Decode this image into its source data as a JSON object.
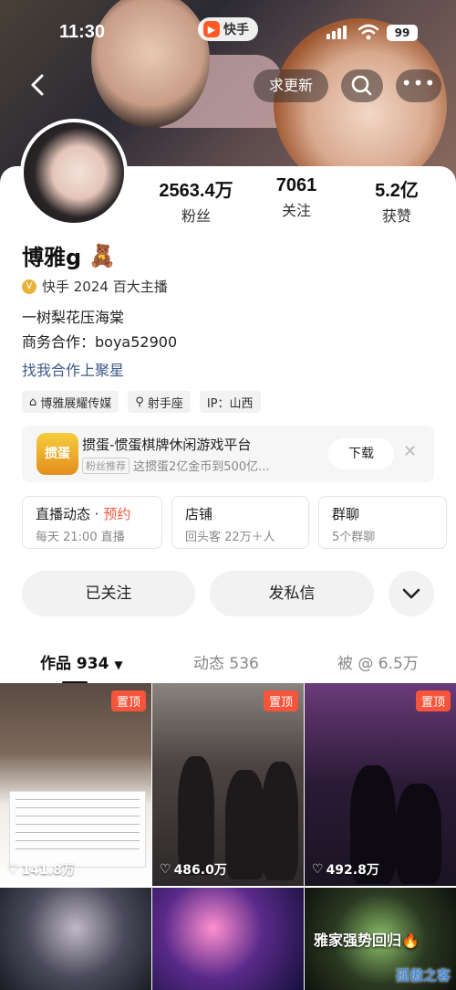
{
  "status_bar": {
    "time": "11:30",
    "app_badge": "快手",
    "battery": "99"
  },
  "header": {
    "update_button": "求更新"
  },
  "profile": {
    "stats": [
      {
        "value": "2563.4万",
        "label": "粉丝"
      },
      {
        "value": "7061",
        "label": "关注"
      },
      {
        "value": "5.2亿",
        "label": "获赞"
      }
    ],
    "name": "博雅g",
    "name_emoji": "🧸",
    "anchor_title": "快手 2024 百大主播",
    "bio_line1": "一树梨花压海棠",
    "bio_line2": "商务合作：boya52900",
    "link_text": "找我合作上聚星",
    "tags": [
      {
        "icon": "building-icon",
        "glyph": "⌂",
        "label": "博雅展耀传媒"
      },
      {
        "icon": "search-icon",
        "glyph": "⚲",
        "label": "射手座"
      },
      {
        "icon": "",
        "glyph": "",
        "label": "IP：山西"
      }
    ]
  },
  "ad": {
    "game_logo_text": "掼蛋",
    "title": "掼蛋-惯蛋棋牌休闲游戏平台",
    "chip": "粉丝推荐",
    "subtitle": "这掼蛋2亿金币到500亿...",
    "download_label": "下载",
    "close_glyph": "✕"
  },
  "boxes": [
    {
      "title": "直播动态",
      "dot": "·",
      "highlight": "预约",
      "sub": "每天 21:00 直播"
    },
    {
      "title": "店铺",
      "dot": "",
      "highlight": "",
      "sub": "回头客 22万＋人"
    },
    {
      "title": "群聊",
      "dot": "",
      "highlight": "",
      "sub": "5个群聊"
    }
  ],
  "actions": {
    "followed": "已关注",
    "message": "发私信",
    "more_glyph": "⌄"
  },
  "tabs": [
    {
      "label": "作品 934",
      "active": true
    },
    {
      "label": "动态 536",
      "active": false
    },
    {
      "label": "被 @ 6.5万",
      "active": false
    }
  ],
  "grid": [
    {
      "pin": "置顶",
      "likes": "141.8万"
    },
    {
      "pin": "置顶",
      "likes": "486.0万"
    },
    {
      "pin": "置顶",
      "likes": "492.8万"
    },
    {
      "caption": ""
    },
    {
      "caption": ""
    },
    {
      "caption": "雅家强势回归🔥"
    }
  ],
  "watermark": "孤傲之客",
  "colors": {
    "accent_red": "#f25b3c",
    "pin_red": "#f6553b",
    "link_blue": "#3c5a8a",
    "kuaishou_orange": "#ff5a26"
  }
}
